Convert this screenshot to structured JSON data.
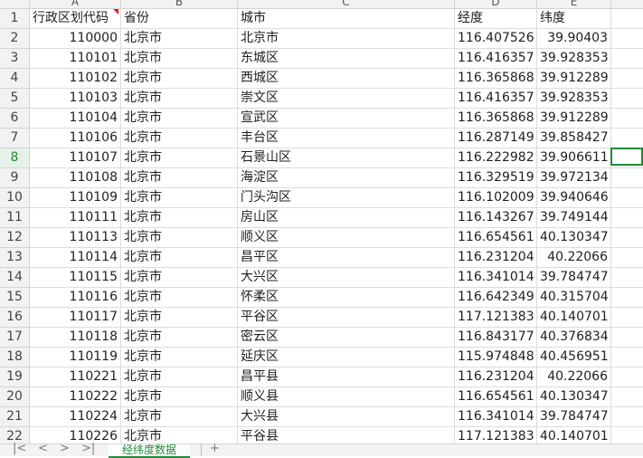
{
  "columns": [
    "A",
    "B",
    "C",
    "D",
    "E"
  ],
  "rows": [
    {
      "n": "1",
      "cells": [
        "行政区划代码",
        "省份",
        "城市",
        "经度",
        "纬度"
      ]
    },
    {
      "n": "2",
      "cells": [
        "110000",
        "北京市",
        "北京市",
        "116.407526",
        "39.90403"
      ]
    },
    {
      "n": "3",
      "cells": [
        "110101",
        "北京市",
        "东城区",
        "116.416357",
        "39.928353"
      ]
    },
    {
      "n": "4",
      "cells": [
        "110102",
        "北京市",
        "西城区",
        "116.365868",
        "39.912289"
      ]
    },
    {
      "n": "5",
      "cells": [
        "110103",
        "北京市",
        "崇文区",
        "116.416357",
        "39.928353"
      ]
    },
    {
      "n": "6",
      "cells": [
        "110104",
        "北京市",
        "宣武区",
        "116.365868",
        "39.912289"
      ]
    },
    {
      "n": "7",
      "cells": [
        "110106",
        "北京市",
        "丰台区",
        "116.287149",
        "39.858427"
      ]
    },
    {
      "n": "8",
      "cells": [
        "110107",
        "北京市",
        "石景山区",
        "116.222982",
        "39.906611"
      ]
    },
    {
      "n": "9",
      "cells": [
        "110108",
        "北京市",
        "海淀区",
        "116.329519",
        "39.972134"
      ]
    },
    {
      "n": "10",
      "cells": [
        "110109",
        "北京市",
        "门头沟区",
        "116.102009",
        "39.940646"
      ]
    },
    {
      "n": "11",
      "cells": [
        "110111",
        "北京市",
        "房山区",
        "116.143267",
        "39.749144"
      ]
    },
    {
      "n": "12",
      "cells": [
        "110113",
        "北京市",
        "顺义区",
        "116.654561",
        "40.130347"
      ]
    },
    {
      "n": "13",
      "cells": [
        "110114",
        "北京市",
        "昌平区",
        "116.231204",
        "40.22066"
      ]
    },
    {
      "n": "14",
      "cells": [
        "110115",
        "北京市",
        "大兴区",
        "116.341014",
        "39.784747"
      ]
    },
    {
      "n": "15",
      "cells": [
        "110116",
        "北京市",
        "怀柔区",
        "116.642349",
        "40.315704"
      ]
    },
    {
      "n": "16",
      "cells": [
        "110117",
        "北京市",
        "平谷区",
        "117.121383",
        "40.140701"
      ]
    },
    {
      "n": "17",
      "cells": [
        "110118",
        "北京市",
        "密云区",
        "116.843177",
        "40.376834"
      ]
    },
    {
      "n": "18",
      "cells": [
        "110119",
        "北京市",
        "延庆区",
        "115.974848",
        "40.456951"
      ]
    },
    {
      "n": "19",
      "cells": [
        "110221",
        "北京市",
        "昌平县",
        "116.231204",
        "40.22066"
      ]
    },
    {
      "n": "20",
      "cells": [
        "110222",
        "北京市",
        "顺义县",
        "116.654561",
        "40.130347"
      ]
    },
    {
      "n": "21",
      "cells": [
        "110224",
        "北京市",
        "大兴县",
        "116.341014",
        "39.784747"
      ]
    },
    {
      "n": "22",
      "cells": [
        "110226",
        "北京市",
        "平谷县",
        "117.121383",
        "40.140701"
      ]
    }
  ],
  "active_row": "8",
  "sheet_tab": "经纬度数据",
  "nav": {
    "first": "|<",
    "prev": "<",
    "next": ">",
    "last": ">|",
    "add": "+"
  }
}
